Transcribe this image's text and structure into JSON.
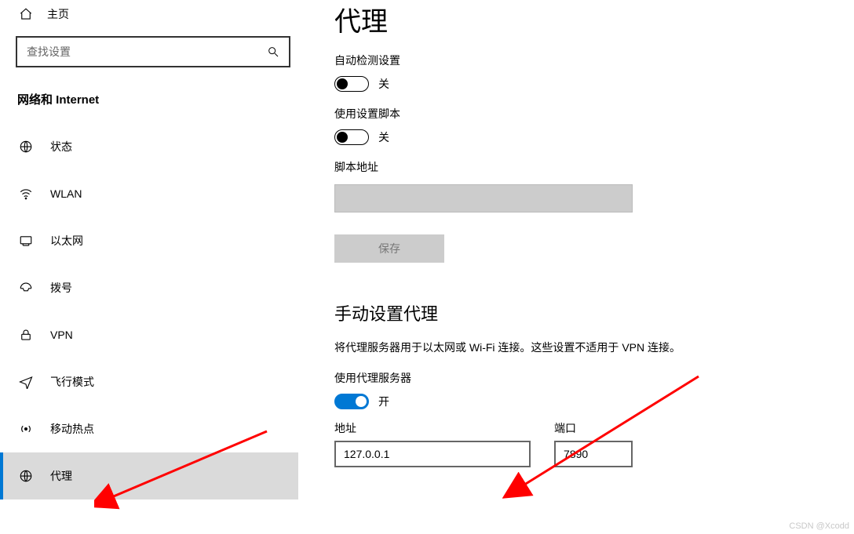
{
  "sidebar": {
    "home_label": "主页",
    "search_placeholder": "查找设置",
    "category_title": "网络和 Internet",
    "items": [
      {
        "icon": "status-icon",
        "label": "状态"
      },
      {
        "icon": "wlan-icon",
        "label": "WLAN"
      },
      {
        "icon": "ethernet-icon",
        "label": "以太网"
      },
      {
        "icon": "dialup-icon",
        "label": "拨号"
      },
      {
        "icon": "vpn-icon",
        "label": "VPN"
      },
      {
        "icon": "airplane-icon",
        "label": "飞行模式"
      },
      {
        "icon": "hotspot-icon",
        "label": "移动热点"
      },
      {
        "icon": "proxy-icon",
        "label": "代理",
        "selected": true
      }
    ]
  },
  "main": {
    "page_title": "代理",
    "auto_detect": {
      "label": "自动检测设置",
      "state_text": "关",
      "on": false
    },
    "setup_script": {
      "label": "使用设置脚本",
      "state_text": "关",
      "on": false
    },
    "script_address": {
      "label": "脚本地址",
      "value": ""
    },
    "save_label": "保存",
    "manual": {
      "title": "手动设置代理",
      "description": "将代理服务器用于以太网或 Wi-Fi 连接。这些设置不适用于 VPN 连接。",
      "use_proxy": {
        "label": "使用代理服务器",
        "state_text": "开",
        "on": true
      },
      "address": {
        "label": "地址",
        "value": "127.0.0.1"
      },
      "port": {
        "label": "端口",
        "value": "7890"
      }
    }
  },
  "watermark": "CSDN @Xcodd"
}
